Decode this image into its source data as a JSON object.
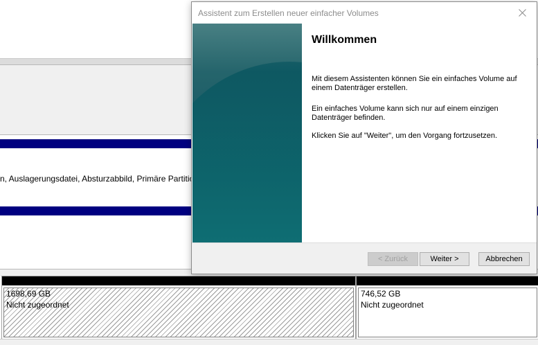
{
  "background": {
    "volume1_description": "n, Auslagerungsdatei, Absturzabbild, Primäre Partitio",
    "partitions": [
      {
        "size": "1698,69 GB",
        "status": "Nicht zugeordnet"
      },
      {
        "size": "746,52 GB",
        "status": "Nicht zugeordnet"
      }
    ]
  },
  "dialog": {
    "title": "Assistent zum Erstellen neuer einfacher Volumes",
    "heading": "Willkommen",
    "paragraphs": [
      "Mit diesem Assistenten können Sie ein einfaches Volume auf einem Datenträger erstellen.",
      "Ein einfaches Volume kann sich nur auf einem einzigen Datenträger befinden.",
      "Klicken Sie auf \"Weiter\", um den Vorgang fortzusetzen."
    ],
    "buttons": {
      "back": "< Zurück",
      "next": "Weiter >",
      "cancel": "Abbrechen"
    }
  },
  "colors": {
    "volume_header": "#000080",
    "partition_header": "#000000",
    "banner_teal": "#0f6a6e"
  },
  "icons": {
    "close": "close-icon"
  }
}
